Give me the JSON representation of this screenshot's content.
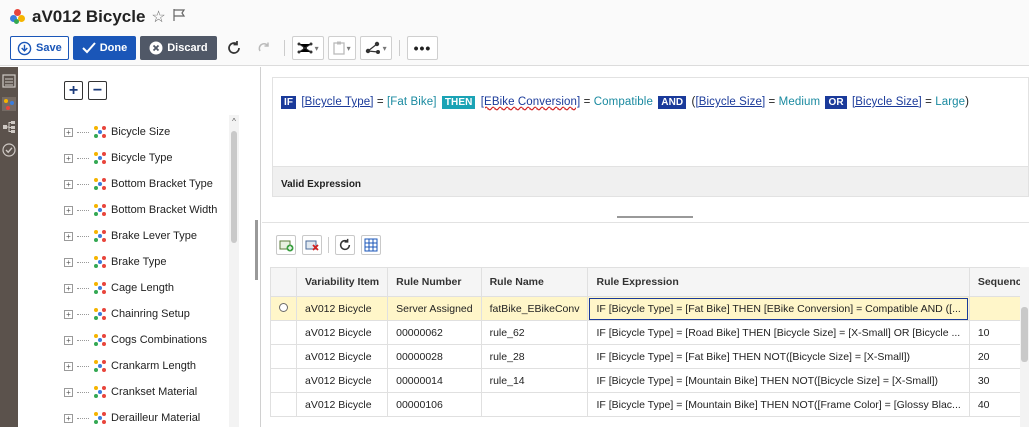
{
  "window": {
    "title": "aV012 Bicycle",
    "icons": [
      "star-outline-icon",
      "flag-outline-icon"
    ]
  },
  "toolbar": {
    "save_label": "Save",
    "done_label": "Done",
    "discard_label": "Discard"
  },
  "colors": {
    "primary": "#1a56b8",
    "discard": "#505867",
    "rail": "#5b524c",
    "keyword": "#1a3a9a",
    "then_keyword": "#1aa3b5",
    "selected_row": "#fff6c9"
  },
  "tree": {
    "items": [
      {
        "label": "Bicycle Size"
      },
      {
        "label": "Bicycle Type"
      },
      {
        "label": "Bottom Bracket Type"
      },
      {
        "label": "Bottom Bracket Width"
      },
      {
        "label": "Brake Lever Type"
      },
      {
        "label": "Brake Type"
      },
      {
        "label": "Cage Length"
      },
      {
        "label": "Chainring Setup"
      },
      {
        "label": "Cogs Combinations"
      },
      {
        "label": "Crankarm Length"
      },
      {
        "label": "Crankset Material"
      },
      {
        "label": "Derailleur Material"
      }
    ]
  },
  "expression": {
    "tokens": {
      "if": "IF",
      "ref1": "[Bicycle Type]",
      "eq1": "=",
      "val1": "[Fat Bike]",
      "then": "THEN",
      "ref2": "[EBike Conversion]",
      "eq2": "=",
      "val2": "Compatible",
      "and": "AND",
      "paren_open": "(",
      "ref3": "[Bicycle Size]",
      "eq3": "=",
      "val3": "Medium",
      "or": "OR",
      "ref4": "[Bicycle Size]",
      "eq4": "=",
      "val4": "Large",
      "paren_close": ")"
    },
    "status": "Valid Expression"
  },
  "grid": {
    "columns": [
      "Variability Item",
      "Rule Number",
      "Rule Name",
      "Rule Expression",
      "Sequence"
    ],
    "rows": [
      {
        "item": "aV012 Bicycle",
        "number": "Server Assigned",
        "name": "fatBike_EBikeConv",
        "expression": "IF [Bicycle Type] = [Fat Bike] THEN [EBike Conversion] = Compatible AND ([...",
        "sequence": ""
      },
      {
        "item": "aV012 Bicycle",
        "number": "00000062",
        "name": "rule_62",
        "expression": "IF [Bicycle Type] = [Road Bike] THEN [Bicycle Size] = [X-Small] OR [Bicycle ...",
        "sequence": "10"
      },
      {
        "item": "aV012 Bicycle",
        "number": "00000028",
        "name": "rule_28",
        "expression": "IF [Bicycle Type] = [Fat Bike] THEN NOT([Bicycle Size] = [X-Small])",
        "sequence": "20"
      },
      {
        "item": "aV012 Bicycle",
        "number": "00000014",
        "name": "rule_14",
        "expression": "IF [Bicycle Type] = [Mountain Bike] THEN NOT([Bicycle Size] = [X-Small])",
        "sequence": "30"
      },
      {
        "item": "aV012 Bicycle",
        "number": "00000106",
        "name": "",
        "expression": "IF [Bicycle Type] = [Mountain Bike] THEN NOT([Frame Color] = [Glossy Blac...",
        "sequence": "40"
      }
    ]
  }
}
